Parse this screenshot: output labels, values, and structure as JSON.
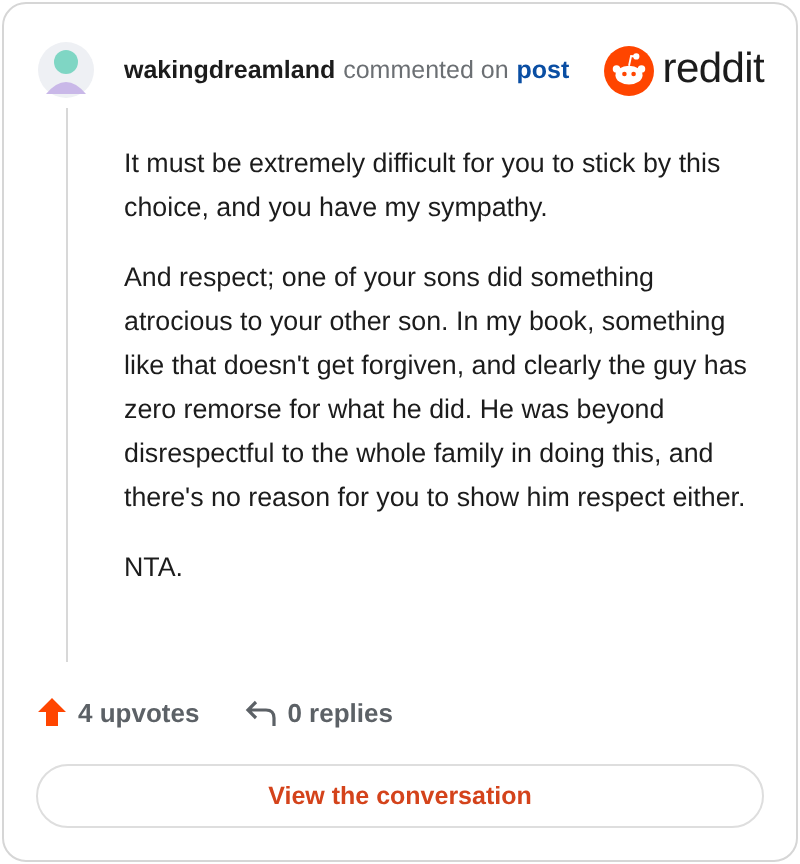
{
  "comment": {
    "author": "wakingdreamland",
    "action": "commented on",
    "link": "post",
    "brand": "reddit",
    "paragraphs": [
      "It must be extremely difficult for you to stick by this choice, and you have my sympathy.",
      "And respect; one of your sons did something atrocious to your other son. In my book, something like that doesn't get forgiven, and clearly the guy has zero remorse for what he did. He was beyond disrespectful to the whole family in doing this, and there's no reason for you to show him respect either.",
      "NTA."
    ],
    "upvotes": "4 upvotes",
    "replies": "0 replies"
  },
  "button": "View the conversation"
}
